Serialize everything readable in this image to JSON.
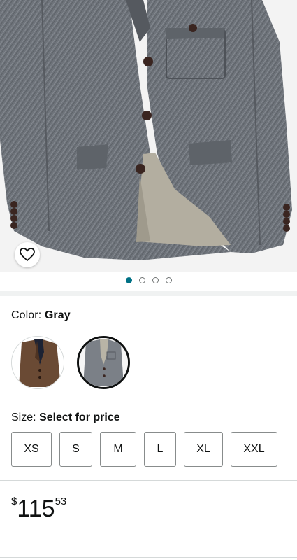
{
  "product_image": {
    "alt": "Gray herringbone tweed blazer"
  },
  "wishlist": {
    "icon": "heart-icon"
  },
  "carousel": {
    "count": 4,
    "active": 0
  },
  "color": {
    "label": "Color: ",
    "selected": "Gray",
    "options": [
      "Brown",
      "Gray"
    ]
  },
  "size": {
    "label": "Size: ",
    "value": "Select for price",
    "options": [
      "XS",
      "S",
      "M",
      "L",
      "XL",
      "XXL"
    ]
  },
  "price": {
    "symbol": "$",
    "whole": "115",
    "fraction": "53"
  },
  "colors": {
    "accent": "#007185",
    "text": "#0f1111",
    "border": "#888c8c"
  }
}
